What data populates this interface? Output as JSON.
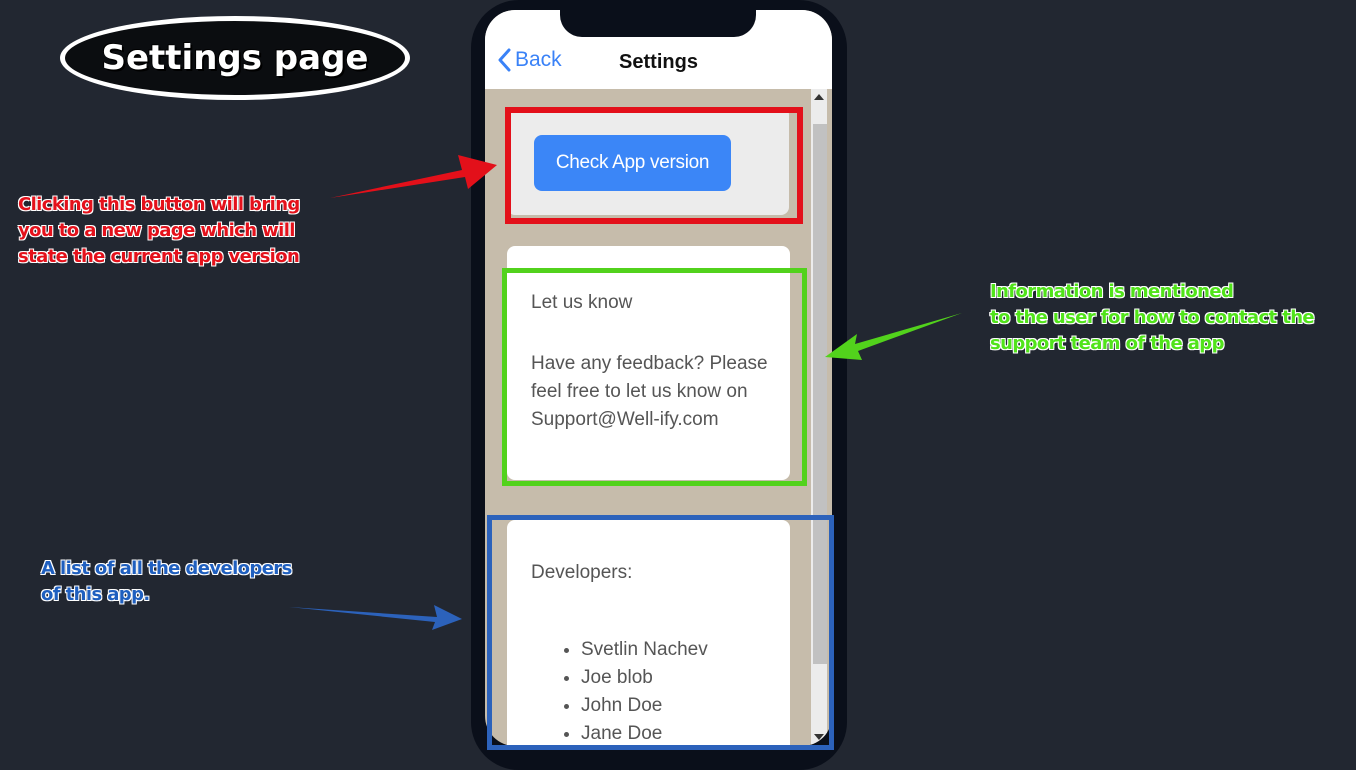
{
  "annotation_title": "Settings page",
  "notes": {
    "red": "Clicking this button will bring\nyou to a new page which will\nstate the current app version",
    "green": "Information is mentioned\nto the user for how to contact the\nsupport team of the app",
    "blue": "A list of all the developers\nof this app."
  },
  "navbar": {
    "back_label": "Back",
    "title": "Settings"
  },
  "version_card": {
    "button_label": "Check App version"
  },
  "contact_card": {
    "heading": "Let us know",
    "body": "Have any feedback? Please feel free to let us know on Support@Well-ify.com"
  },
  "developers_card": {
    "heading": "Developers:",
    "items": [
      "Svetlin Nachev",
      "Joe blob",
      "John Doe",
      "Jane Doe"
    ]
  },
  "colors": {
    "background": "#222731",
    "accent": "#3b86f7",
    "highlight_red": "#e3101a",
    "highlight_green": "#52d21c",
    "highlight_blue": "#2c62bb"
  }
}
